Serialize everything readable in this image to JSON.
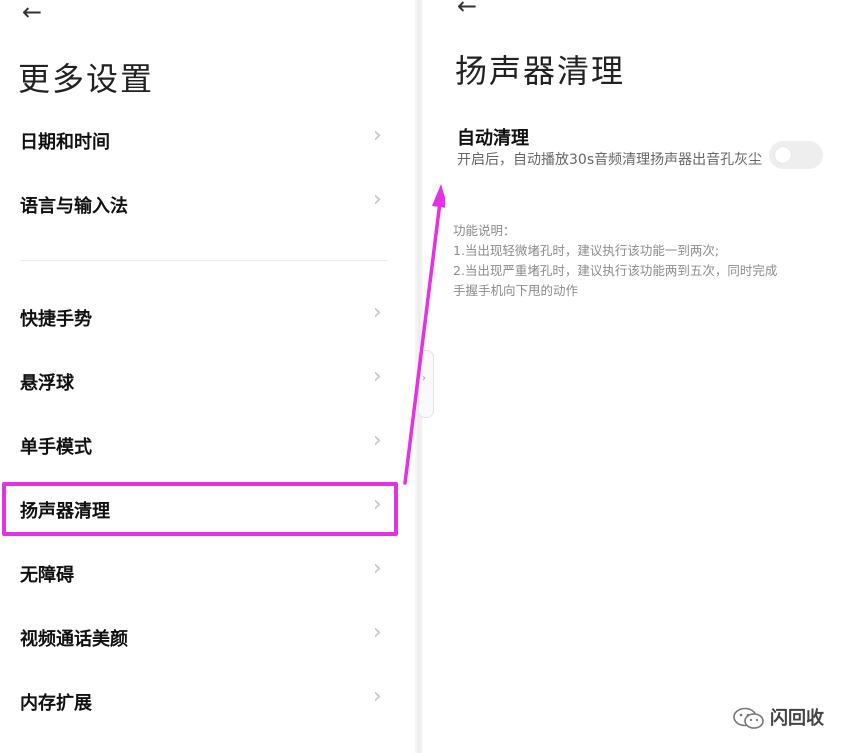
{
  "left_panel": {
    "back_icon": "←",
    "title": "更多设置",
    "items": [
      {
        "label": "日期和时间"
      },
      {
        "label": "语言与输入法"
      },
      {
        "label": "快捷手势"
      },
      {
        "label": "悬浮球"
      },
      {
        "label": "单手模式"
      },
      {
        "label": "扬声器清理"
      },
      {
        "label": "无障碍"
      },
      {
        "label": "视频通话美颜"
      },
      {
        "label": "内存扩展"
      }
    ],
    "chevron_icon": "›",
    "highlight_color": "#e530e3"
  },
  "right_panel": {
    "back_icon": "←",
    "title": "扬声器清理",
    "setting": {
      "title": "自动清理",
      "description": "开启后，自动播放30s音频清理扬声器出音孔灰尘",
      "toggle_on": false
    },
    "info": {
      "heading": "功能说明：",
      "line1": "1.当出现轻微堵孔时，建议执行该功能一到两次;",
      "line2": "2.当出现严重堵孔时，建议执行该功能两到五次，同时完成",
      "line3": "手握手机向下甩的动作"
    }
  },
  "watermark": {
    "text": "闪回收",
    "icon": "wechat-icon"
  },
  "colors": {
    "accent": "#e530e3",
    "toggle_off": "#eeeeee",
    "chevron": "#c4c4c4",
    "secondary_text": "#666666"
  }
}
